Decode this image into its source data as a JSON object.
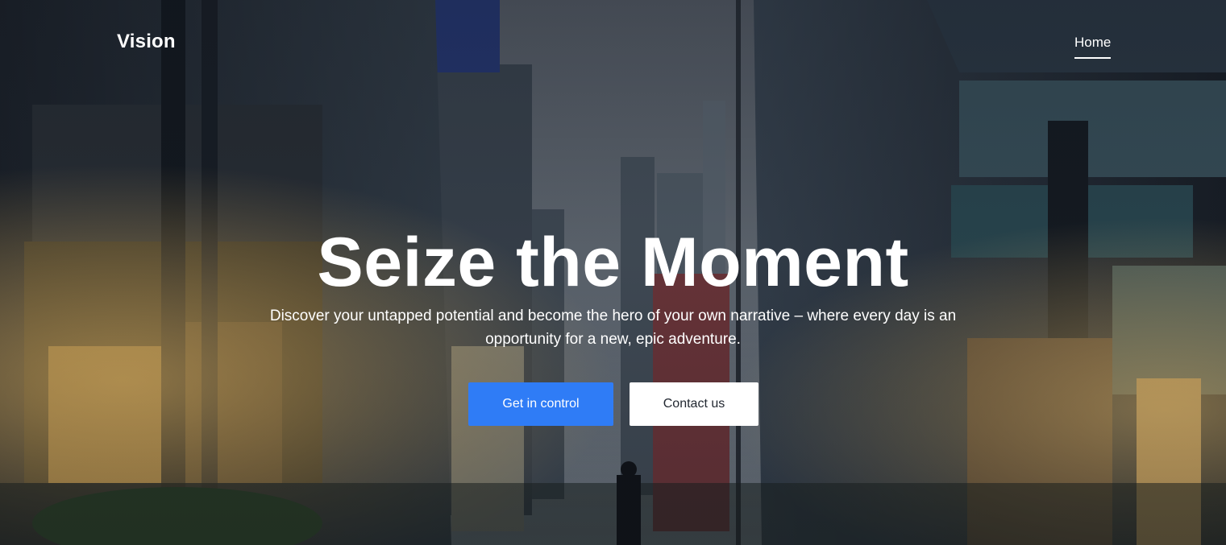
{
  "navbar": {
    "brand": "Vision",
    "links": [
      {
        "label": "Home",
        "active": true
      }
    ]
  },
  "hero": {
    "title": "Seize the Moment",
    "subtitle": "Discover your untapped potential and become the hero of your own narrative – where every day is an opportunity for a new, epic adventure.",
    "primary_button": "Get in control",
    "secondary_button": "Contact us"
  },
  "colors": {
    "primary": "#2f7cf6",
    "text_on_dark": "#ffffff",
    "secondary_bg": "#ffffff",
    "secondary_text": "#222831"
  }
}
